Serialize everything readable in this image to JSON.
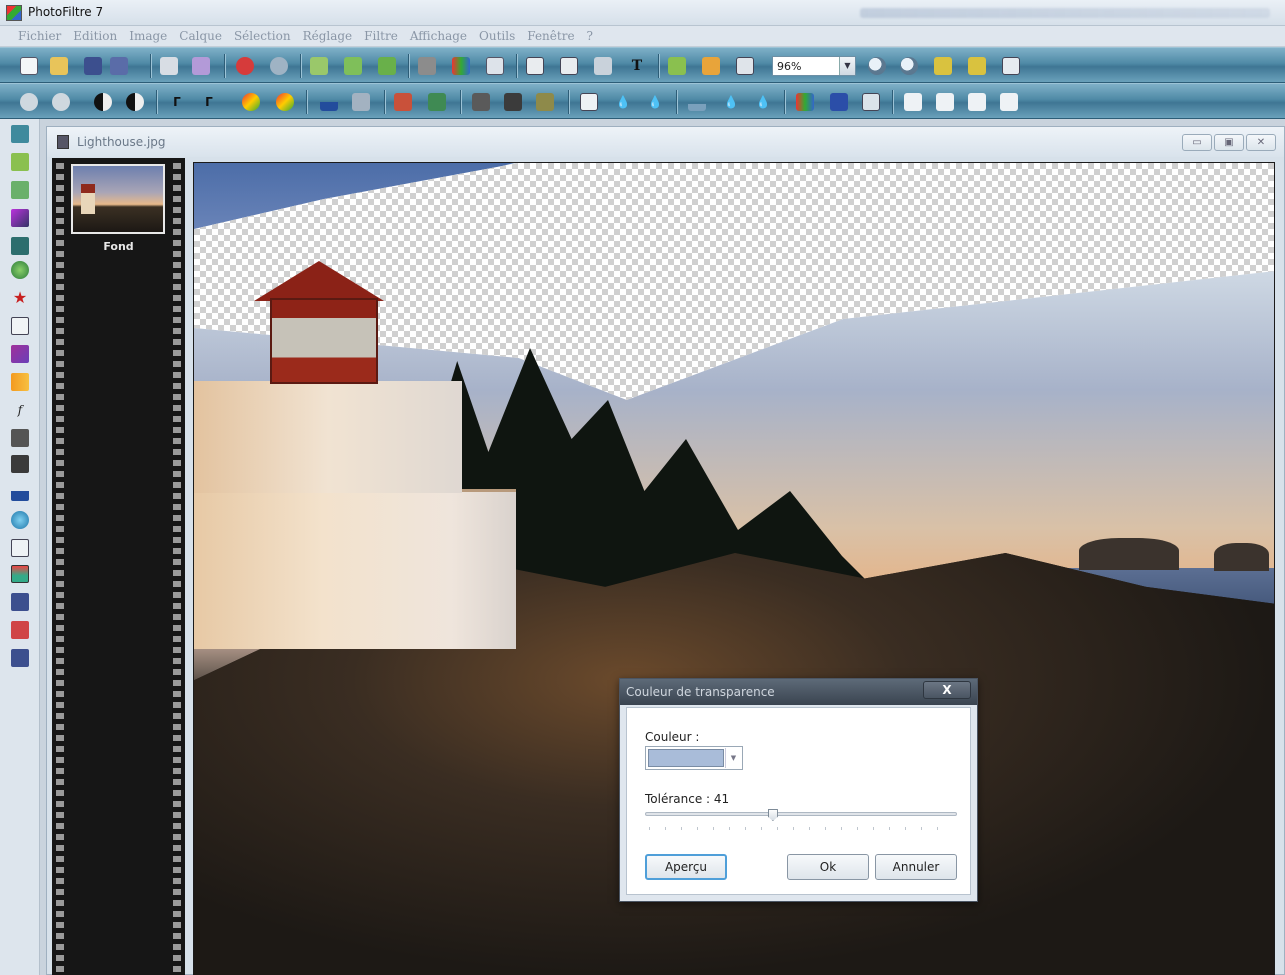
{
  "window": {
    "title": "PhotoFiltre 7"
  },
  "menu": [
    "Fichier",
    "Edition",
    "Image",
    "Calque",
    "Sélection",
    "Réglage",
    "Filtre",
    "Affichage",
    "Outils",
    "Fenêtre",
    "?"
  ],
  "toolbar": {
    "zoom_value": "96%"
  },
  "document": {
    "title": "Lighthouse.jpg",
    "layer_label": "Fond"
  },
  "dialog": {
    "title": "Couleur de transparence",
    "close_label": "X",
    "color_label": "Couleur :",
    "selected_color": "#a9bcd9",
    "tolerance_label": "Tolérance : 41",
    "tolerance_value": 41,
    "tolerance_max": 100,
    "buttons": {
      "preview": "Aperçu",
      "ok": "Ok",
      "cancel": "Annuler"
    }
  },
  "colors": {
    "accent": "#4f9fd9",
    "toolbar": "#4f8aa6"
  }
}
